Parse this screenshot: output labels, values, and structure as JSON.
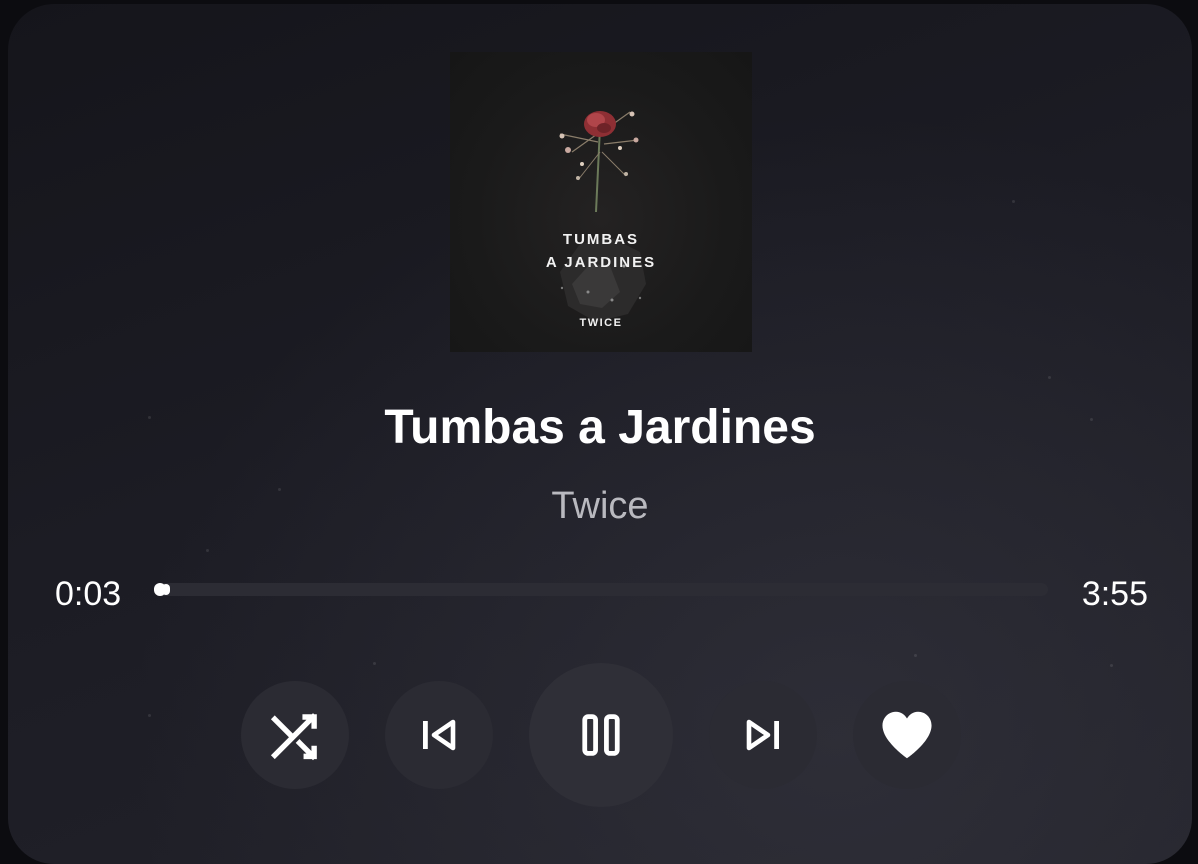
{
  "track": {
    "title": "Tumbas a Jardines",
    "artist": "Twice",
    "cover_art": {
      "title_text": "TUMBAS\nA JARDINES",
      "artist_text": "TWICE"
    }
  },
  "playback": {
    "current_time": "0:03",
    "total_time": "3:55",
    "progress": 0.013,
    "state": "playing"
  },
  "controls": [
    {
      "id": "shuffle",
      "icon": "shuffle-icon"
    },
    {
      "id": "previous",
      "icon": "skip-previous-icon"
    },
    {
      "id": "pause",
      "icon": "pause-icon"
    },
    {
      "id": "next",
      "icon": "skip-next-icon"
    },
    {
      "id": "favorite",
      "icon": "heart-icon"
    }
  ],
  "colors": {
    "background": "#1c1c24",
    "button": "#2b2b33",
    "text_primary": "#ffffff",
    "text_secondary": "#b9b9bf",
    "track": "#2c2c34"
  }
}
